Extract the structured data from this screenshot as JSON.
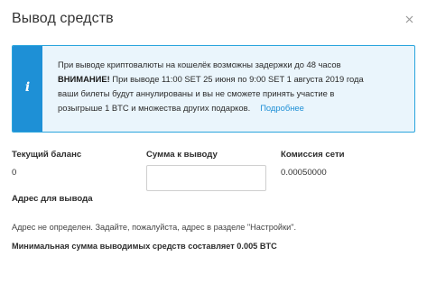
{
  "dialog": {
    "title": "Вывод средств",
    "close_icon": "close-icon"
  },
  "alert": {
    "icon": "info-icon",
    "icon_glyph": "i",
    "line1": "При выводе криптовалюты на кошелёк возможны задержки до 48 часов",
    "warning_label": "ВНИМАНИЕ!",
    "line2": " При выводе 11:00 SET 25 июня по 9:00 SET 1 августа 2019 года",
    "line3": "ваши билеты будут аннулированы и вы не сможете принять участие в",
    "line4": "розыгрыше 1 BTC и множества других подарков.",
    "link_label": "Подробнее",
    "colors": {
      "border": "#2aa5dd",
      "strip": "#1e90d6",
      "background": "#eaf5fc",
      "link": "#1e8fd6"
    }
  },
  "balance": {
    "label": "Текущий баланс",
    "value": "0"
  },
  "amount": {
    "label": "Сумма к выводу",
    "value": "",
    "placeholder": ""
  },
  "fee": {
    "label": "Комиссия сети",
    "value": "0.00050000"
  },
  "address": {
    "label": "Адрес для вывода",
    "note": "Адрес не определен. Задайте, пожалуйста, адрес в разделе \"Настройки\"."
  },
  "min_withdrawal_note": "Минимальная сумма выводимых средств составляет 0.005 BTC"
}
